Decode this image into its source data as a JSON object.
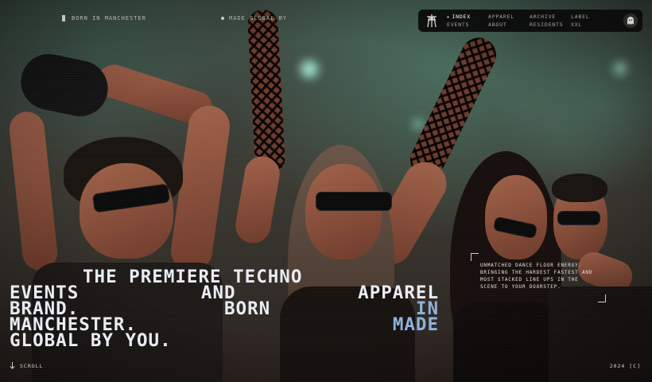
{
  "top": {
    "tag_left": "BORN IN MANCHESTER",
    "tag_right": "MADE GLOBAL BY"
  },
  "nav": {
    "logo_icon": "pylon-icon",
    "columns": [
      [
        "INDEX",
        "EVENTS"
      ],
      [
        "APPAREL",
        "ABOUT"
      ],
      [
        "ARCHIVE",
        "RESIDENTS"
      ],
      [
        "LABEL",
        "XXL"
      ]
    ],
    "active": "INDEX",
    "badge_icon": "ghost-icon"
  },
  "headline": {
    "row1": "THE PREMIERE TECHNO",
    "row2": [
      "EVENTS",
      "AND",
      "APPAREL"
    ],
    "row3": [
      "BRAND.",
      "BORN",
      "IN"
    ],
    "row4": [
      "MANCHESTER.",
      "MADE"
    ],
    "row5": "GLOBAL BY YOU."
  },
  "blurb": "UNMATCHED DANCE FLOOR ENERGY. BRINGING THE HARDEST FASTEST AND MOST STACKED LINE UPS IN THE SCENE TO YOUR DOORSTEP.",
  "footer": {
    "scroll_label": "SCROLL",
    "year": "2024 [C]"
  },
  "colors": {
    "headline": "#e9ecf3",
    "highlight": "#8fb2dc",
    "nav_bg": "#0a0a0a"
  }
}
